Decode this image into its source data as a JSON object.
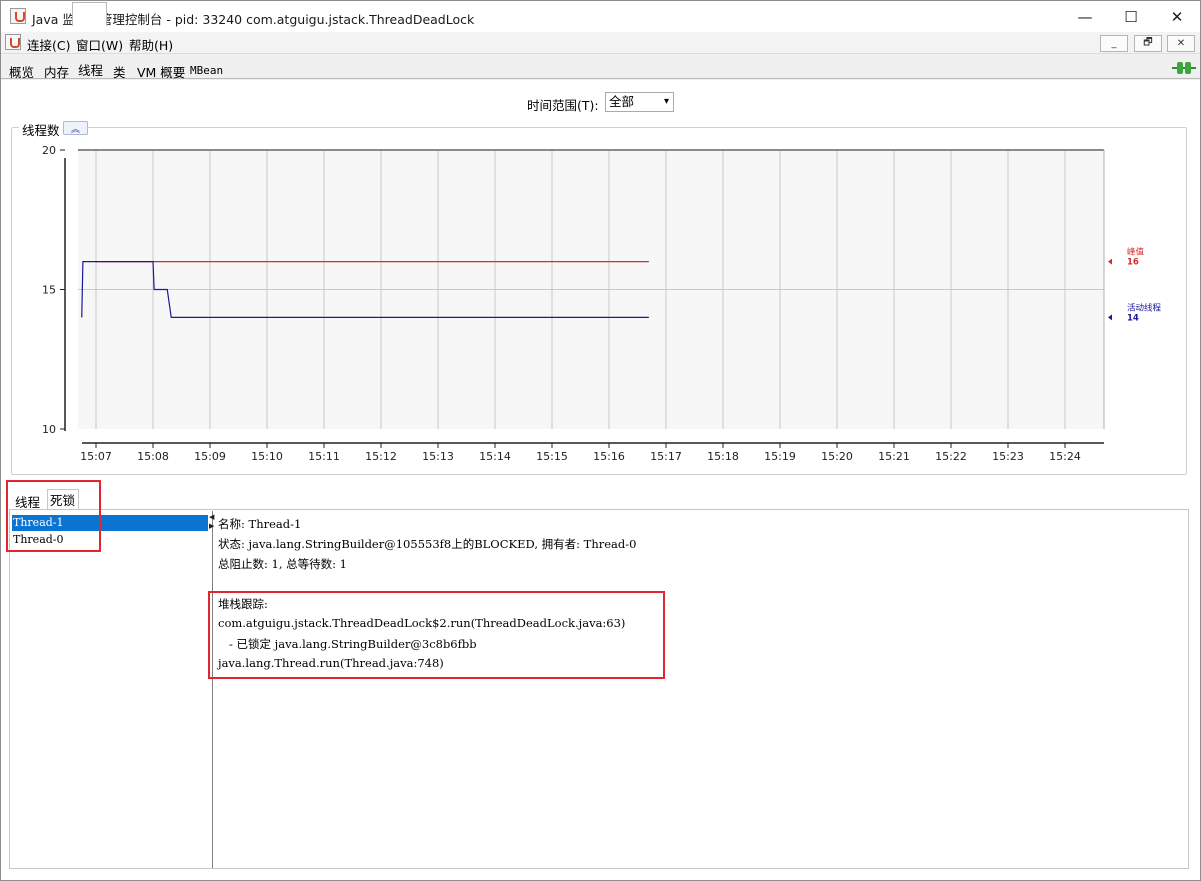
{
  "window": {
    "title": "Java 监视和管理控制台 - pid: 33240 com.atguigu.jstack.ThreadDeadLock",
    "controls": {
      "minimize": "—",
      "maximize": "☐",
      "close": "✕"
    }
  },
  "menubar": {
    "items": [
      {
        "label": "连接(C)"
      },
      {
        "label": "窗口(W)"
      },
      {
        "label": "帮助(H)"
      }
    ],
    "mdi_controls": [
      "_",
      "🗗",
      "✕"
    ]
  },
  "tabs": [
    {
      "label": "概览",
      "selected": false
    },
    {
      "label": "内存",
      "selected": false
    },
    {
      "label": "线程",
      "selected": true
    },
    {
      "label": "类",
      "selected": false
    },
    {
      "label": "VM 概要",
      "selected": false
    },
    {
      "label": "MBean",
      "selected": false
    }
  ],
  "time_range": {
    "label": "时间范围(T):",
    "value": "全部"
  },
  "chart_panel": {
    "title": "线程数",
    "collapse_glyph": "︽"
  },
  "chart_data": {
    "type": "line",
    "title": "线程数",
    "ylim": [
      10,
      20
    ],
    "y_ticks": [
      "20",
      "15",
      "10"
    ],
    "x_ticks": [
      "15:07",
      "15:08",
      "15:09",
      "15:10",
      "15:11",
      "15:12",
      "15:13",
      "15:14",
      "15:15",
      "15:16",
      "15:17",
      "15:18",
      "15:19",
      "15:20",
      "15:21",
      "15:22",
      "15:23",
      "15:24"
    ],
    "grid": true,
    "legend_position": "right",
    "series": [
      {
        "name": "峰值",
        "color": "#d52b2b",
        "last_value": "16",
        "points": [
          [
            15.0,
            16
          ],
          [
            24.7,
            16
          ]
        ]
      },
      {
        "name": "活动线程",
        "color": "#1a1a9c",
        "last_value": "14",
        "points": [
          [
            14.75,
            14
          ],
          [
            14.77,
            16
          ],
          [
            15.0,
            16
          ],
          [
            16.0,
            16
          ],
          [
            16.02,
            15
          ],
          [
            16.25,
            15
          ],
          [
            16.32,
            14
          ],
          [
            24.7,
            14
          ]
        ]
      }
    ]
  },
  "lower_tabs": [
    {
      "label": "线程",
      "selected": false
    },
    {
      "label": "死锁",
      "selected": true
    }
  ],
  "threads": [
    {
      "name": "Thread-1",
      "selected": true
    },
    {
      "name": "Thread-0",
      "selected": false
    }
  ],
  "detail": {
    "name_line": "名称: Thread-1",
    "state_line": "状态: java.lang.StringBuilder@105553f8上的BLOCKED, 拥有者: Thread-0",
    "counts_line": "总阻止数: 1, 总等待数: 1",
    "stack_title": "堆栈跟踪:",
    "stack_lines": [
      "com.atguigu.jstack.ThreadDeadLock$2.run(ThreadDeadLock.java:63)",
      "   - 已锁定 java.lang.StringBuilder@3c8b6fbb",
      "java.lang.Thread.run(Thread.java:748)"
    ]
  }
}
